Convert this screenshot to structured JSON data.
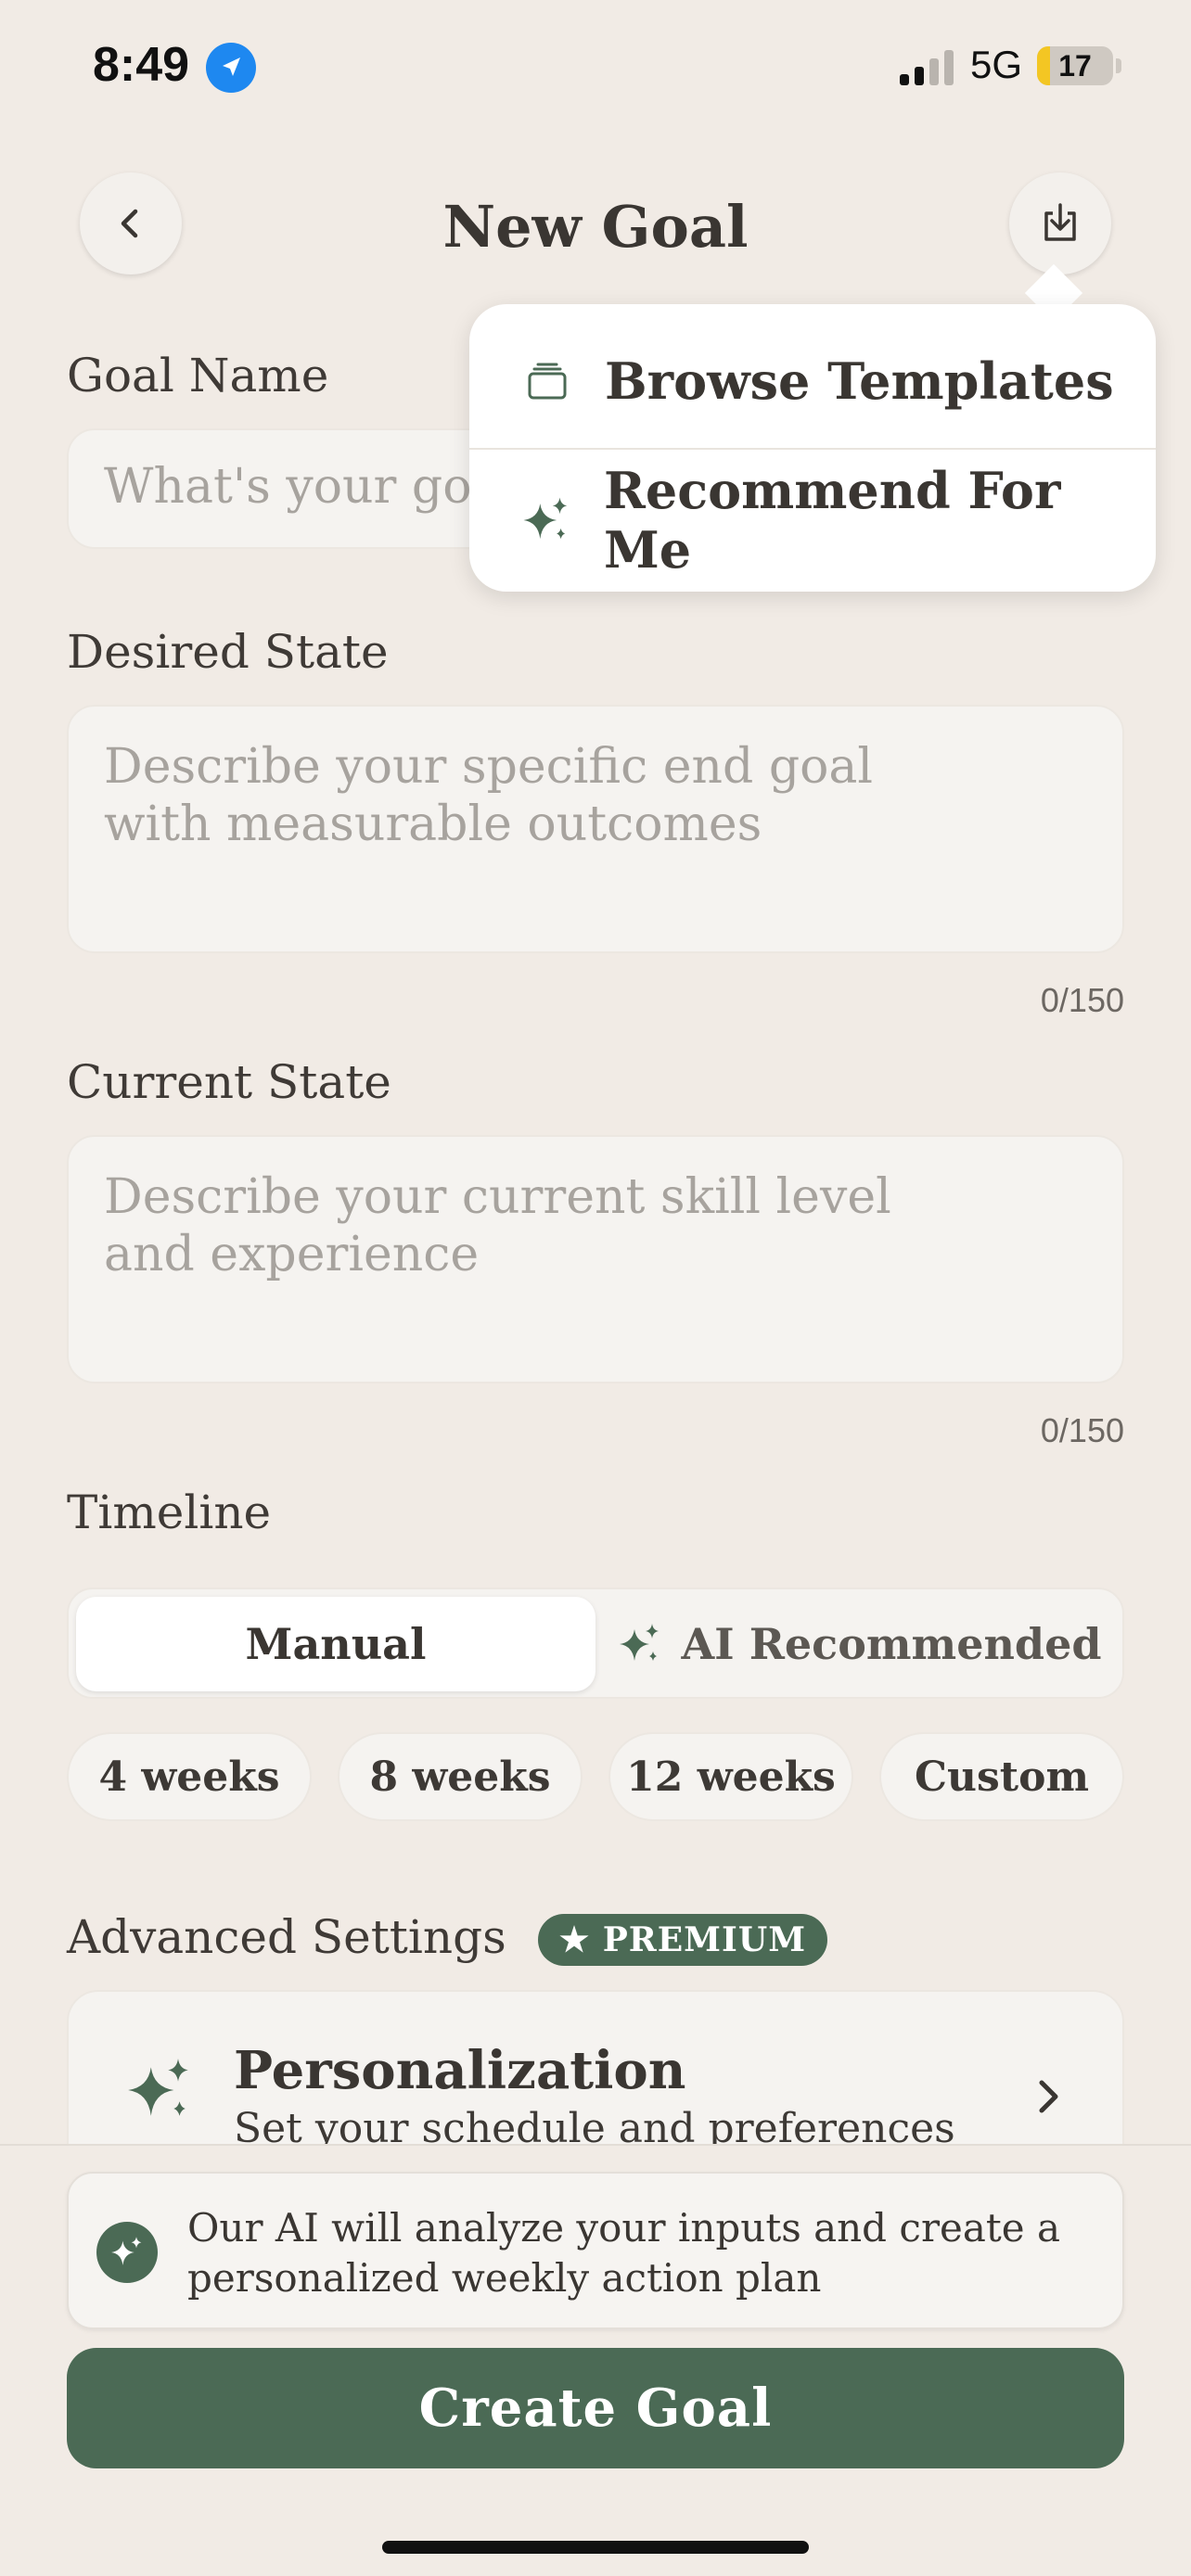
{
  "status_bar": {
    "time": "8:49",
    "network": "5G",
    "battery": "17",
    "battery_level": 0.17
  },
  "header": {
    "title": "New Goal",
    "back_icon": "chevron-left-icon",
    "import_icon": "download-tray-icon"
  },
  "dropdown": {
    "items": [
      {
        "label": "Browse Templates",
        "icon": "stack-icon"
      },
      {
        "label": "Recommend For Me",
        "icon": "sparkles-icon"
      }
    ]
  },
  "form": {
    "goal_name": {
      "label": "Goal Name",
      "placeholder": "What's your goal?"
    },
    "desired_state": {
      "label": "Desired State",
      "placeholder": "Describe your specific end goal with measurable outcomes",
      "counter": "0/150"
    },
    "current_state": {
      "label": "Current State",
      "placeholder": "Describe your current skill level and experience",
      "counter": "0/150"
    },
    "timeline": {
      "label": "Timeline",
      "modes": [
        "Manual",
        "AI Recommended"
      ],
      "selected_mode": "Manual",
      "options": [
        "4 weeks",
        "8 weeks",
        "12 weeks",
        "Custom"
      ]
    },
    "advanced": {
      "label": "Advanced Settings",
      "badge": "★ PREMIUM",
      "card": {
        "title": "Personalization",
        "subtitle": "Set your schedule and preferences"
      }
    }
  },
  "footer": {
    "info_text": "Our AI will analyze your inputs and create a personalized weekly action plan",
    "create_label": "Create Goal"
  },
  "colors": {
    "accent": "#4b6a55",
    "background": "#f1ebe5",
    "field": "#f5f3f0",
    "status_blue": "#1e88f0",
    "battery_yellow": "#f3c623"
  }
}
